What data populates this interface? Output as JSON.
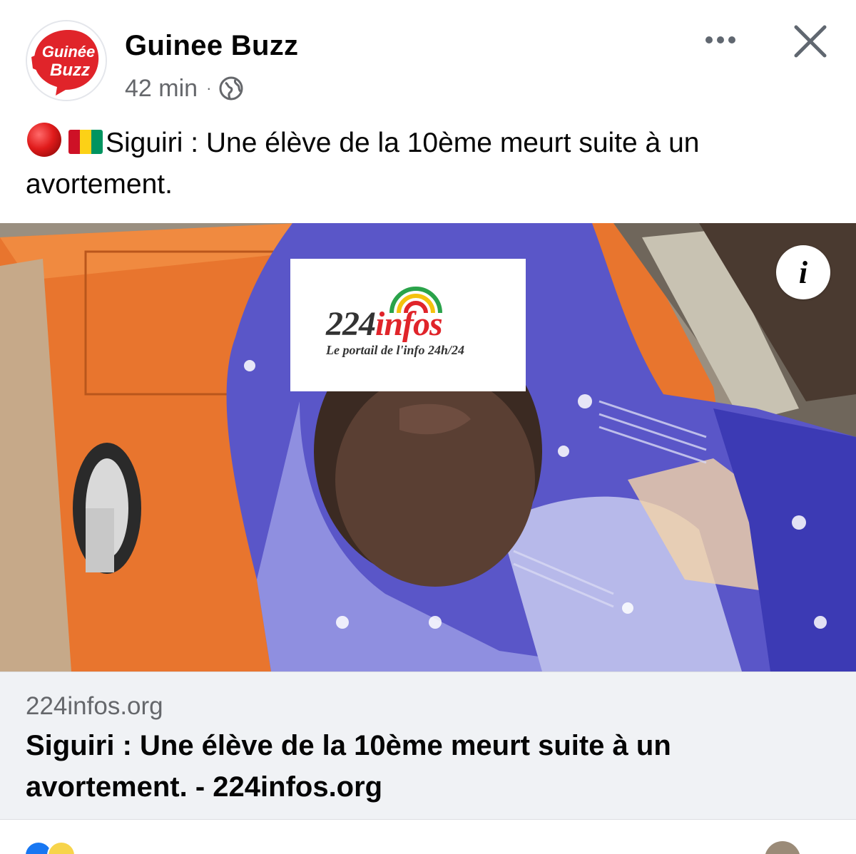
{
  "post": {
    "page_name": "Guinee Buzz",
    "page_avatar_text": "Guinée Buzz",
    "time": "42 min",
    "separator": "·",
    "privacy_icon": "globe-icon",
    "more_icon": "more-horizontal-icon",
    "close_icon": "close-icon",
    "text": "Siguiri : Une élève de la 10ème meurt suite à un avortement.",
    "emoji": [
      "red-circle",
      "guinea-flag"
    ]
  },
  "image": {
    "watermark_brand_number": "224",
    "watermark_brand_word": "infos",
    "watermark_tagline": "Le portail de l'info 24h/24",
    "info_icon": "info-icon",
    "info_label": "i"
  },
  "link_preview": {
    "domain": "224infos.org",
    "title": "Siguiri : Une élève de la 10ème meurt suite à un avortement. - 224infos.org"
  },
  "colors": {
    "brand_red": "#e0242a",
    "guinea_red": "#ce1126",
    "guinea_yellow": "#fcd116",
    "guinea_green": "#009460",
    "link_card_bg": "#f0f2f5",
    "meta_text": "#65676b"
  }
}
